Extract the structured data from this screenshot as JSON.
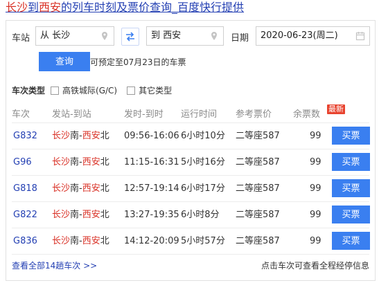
{
  "title": {
    "a": "长沙",
    "b": "到",
    "c": "西安",
    "d": "的列车时刻及票价查询_百度快行提供"
  },
  "search": {
    "from_label": "车站",
    "from_value": "从 长沙",
    "to_value": "到 西安",
    "date_label": "日期",
    "date_value": "2020-06-23(周二)",
    "query_button": "查询",
    "presale_note": "可预定至07月23日的车票"
  },
  "filter": {
    "label": "车次类型",
    "options": [
      "高铁城际(G/C)",
      "其它类型"
    ]
  },
  "table": {
    "headers": [
      "车次",
      "发站-到站",
      "发时-到时",
      "运行时间",
      "参考票价",
      "余票数"
    ],
    "new_badge": "最新",
    "rows": [
      {
        "train": "G832",
        "from": "长沙",
        "from_suffix": "南-",
        "to": "西安",
        "to_suffix": "北",
        "times": "09:56-16:06",
        "duration": "6小时10分",
        "price": "二等座587",
        "remain": "99",
        "action": "买票"
      },
      {
        "train": "G96",
        "from": "长沙",
        "from_suffix": "南-",
        "to": "西安",
        "to_suffix": "北",
        "times": "11:15-16:31",
        "duration": "5小时16分",
        "price": "二等座587",
        "remain": "99",
        "action": "买票"
      },
      {
        "train": "G818",
        "from": "长沙",
        "from_suffix": "南-",
        "to": "西安",
        "to_suffix": "北",
        "times": "12:57-19:14",
        "duration": "6小时17分",
        "price": "二等座587",
        "remain": "99",
        "action": "买票"
      },
      {
        "train": "G822",
        "from": "长沙",
        "from_suffix": "南-",
        "to": "西安",
        "to_suffix": "北",
        "times": "13:27-19:35",
        "duration": "6小时8分",
        "price": "二等座587",
        "remain": "99",
        "action": "买票"
      },
      {
        "train": "G836",
        "from": "长沙",
        "from_suffix": "南-",
        "to": "西安",
        "to_suffix": "北",
        "times": "14:12-20:09",
        "duration": "5小时57分",
        "price": "二等座587",
        "remain": "99",
        "action": "买票"
      }
    ]
  },
  "footer": {
    "more_link": "查看全部14趟车次 >>",
    "hint": "点击车次可查看全程经停信息"
  },
  "icons": {
    "location": "location-pin-icon",
    "swap": "swap-arrows-icon",
    "calendar": "calendar-icon"
  },
  "colors": {
    "accent": "#3a7ff0",
    "link": "#2440b3",
    "highlight": "#d93025"
  }
}
